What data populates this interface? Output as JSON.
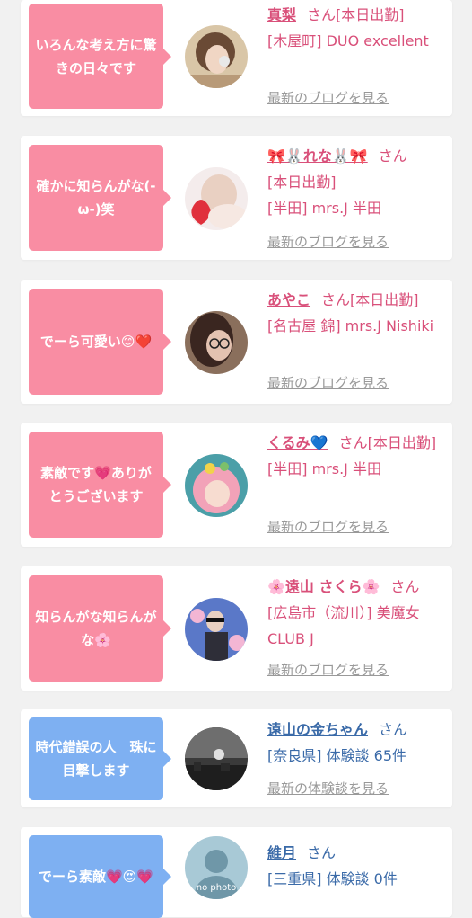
{
  "cards": [
    {
      "bubble": "いろんな考え方に驚きの日々です",
      "name": "真梨",
      "honorific": "さん",
      "status": "[本日出勤]",
      "shop": "[木屋町] DUO excellent",
      "link": "最新のブログを見る"
    },
    {
      "bubble": "確かに知らんがな(-ω-)笑",
      "name": "🎀🐰れな🐰🎀",
      "honorific": "さん",
      "status": "[本日出勤]",
      "shop": "[半田] mrs.J 半田",
      "link": "最新のブログを見る"
    },
    {
      "bubble": "でーら可愛い😊❤️",
      "name": "あやこ",
      "honorific": "さん",
      "status": "[本日出勤]",
      "shop": "[名古屋 錦] mrs.J Nishiki",
      "link": "最新のブログを見る"
    },
    {
      "bubble": "素敵です💗ありがとうございます",
      "name": "くるみ💙",
      "honorific": "さん",
      "status": "[本日出勤]",
      "shop": "[半田] mrs.J 半田",
      "link": "最新のブログを見る"
    },
    {
      "bubble": "知らんがな知らんがな🌸",
      "name": "🌸遠山 さくら🌸",
      "honorific": "さん",
      "status": "",
      "shop": "[広島市（流川）] 美魔女CLUB J",
      "link": "最新のブログを見る"
    },
    {
      "bubble": "時代錯誤の人　珠に目撃します",
      "name": "遠山の金ちゃん",
      "honorific": "さん",
      "status": "",
      "shop": "[奈良県] 体験談 65件",
      "link": "最新の体験談を見る"
    },
    {
      "bubble": "でーら素敵💗😍💗",
      "name": "維月",
      "honorific": "さん",
      "status": "",
      "shop": "[三重県] 体験談 0件",
      "link": ""
    }
  ],
  "no_photo_label": "no photo",
  "colors": {
    "pink_bubble": "#f98da3",
    "blue_bubble": "#7eb0f2",
    "pink_text": "#d9507a",
    "blue_text": "#3a6aa8",
    "link_gray": "#999999"
  }
}
